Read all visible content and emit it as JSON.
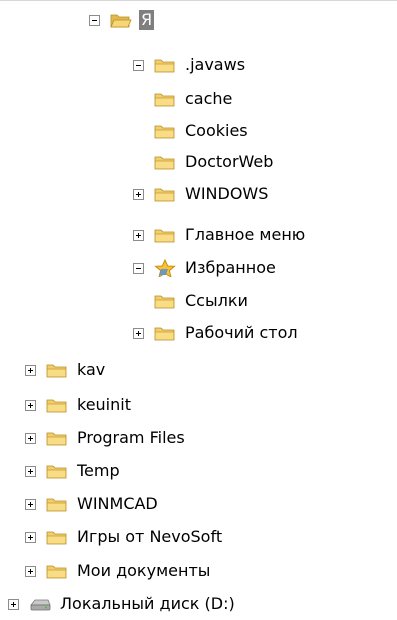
{
  "tree": {
    "items": [
      {
        "label": "Я",
        "expander": "minus",
        "icon": "folder-open-icon",
        "selected": true
      },
      {
        "label": ".javaws",
        "expander": "minus",
        "icon": "folder-icon"
      },
      {
        "label": "cache",
        "expander": "none",
        "icon": "folder-icon"
      },
      {
        "label": "Cookies",
        "expander": "none",
        "icon": "folder-icon"
      },
      {
        "label": "DoctorWeb",
        "expander": "none",
        "icon": "folder-icon"
      },
      {
        "label": "WINDOWS",
        "expander": "plus",
        "icon": "folder-icon"
      },
      {
        "label": "Главное меню",
        "expander": "plus",
        "icon": "folder-icon"
      },
      {
        "label": "Избранное",
        "expander": "minus",
        "icon": "favorites-star-icon"
      },
      {
        "label": "Ссылки",
        "expander": "none",
        "icon": "folder-icon"
      },
      {
        "label": "Рабочий стол",
        "expander": "plus",
        "icon": "folder-icon"
      },
      {
        "label": "kav",
        "expander": "plus",
        "icon": "folder-icon"
      },
      {
        "label": "keuinit",
        "expander": "plus",
        "icon": "folder-icon"
      },
      {
        "label": "Program Files",
        "expander": "plus",
        "icon": "folder-icon"
      },
      {
        "label": "Temp",
        "expander": "plus",
        "icon": "folder-icon"
      },
      {
        "label": "WINMCAD",
        "expander": "plus",
        "icon": "folder-icon"
      },
      {
        "label": "Игры от NevoSoft",
        "expander": "plus",
        "icon": "folder-icon"
      },
      {
        "label": "Мои документы",
        "expander": "plus",
        "icon": "folder-icon"
      },
      {
        "label": "Локальный диск (D:)",
        "expander": "plus",
        "icon": "drive-icon"
      }
    ]
  },
  "colors": {
    "folder": "#f2cd6c",
    "selection": "#7f7f7f",
    "expander_border": "#8c8c8c"
  }
}
